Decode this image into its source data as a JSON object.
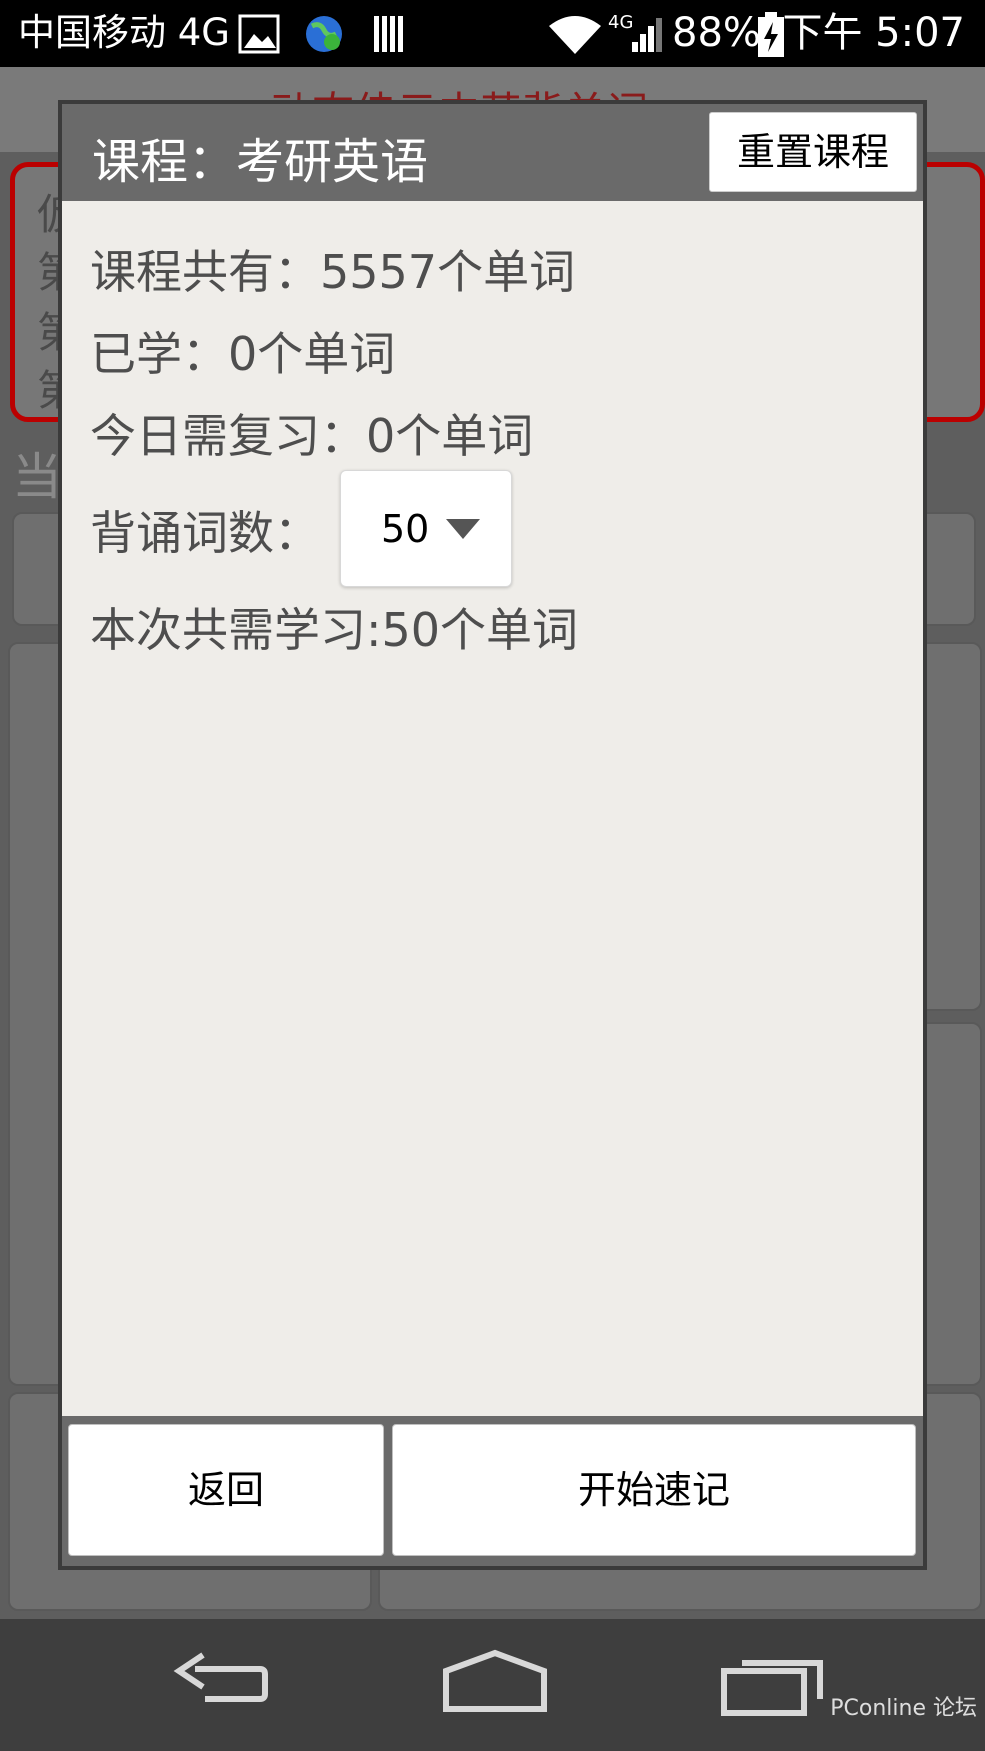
{
  "status_bar": {
    "carrier": "中国移动 4G",
    "battery": "88%",
    "time": "下午 5:07",
    "network": "4G"
  },
  "background": {
    "header_title": "动态佳云中英背单词",
    "panel_lines": [
      "仮",
      "第",
      "第",
      "第"
    ],
    "chip_label": "当"
  },
  "dialog": {
    "title": "课程：考研英语",
    "reset_label": "重置课程",
    "total_words": "课程共有：5557个单词",
    "learned": "已学：0个单词",
    "review_today": "今日需复习：0个单词",
    "recite_label": "背诵词数：",
    "recite_value": "50",
    "session_total": "本次共需学习:50个单词",
    "back_label": "返回",
    "start_label": "开始速记"
  },
  "watermark": "PConline 论坛",
  "colors": {
    "header": "#6a6a6a",
    "dialog_bg": "#efede9",
    "accent_red": "#bb0000"
  },
  "icons": [
    "image-icon",
    "globe-sync-icon",
    "barcode-icon",
    "wifi-icon",
    "signal-icon",
    "battery-charging-icon",
    "back-nav-icon",
    "home-nav-icon",
    "recent-apps-icon"
  ]
}
